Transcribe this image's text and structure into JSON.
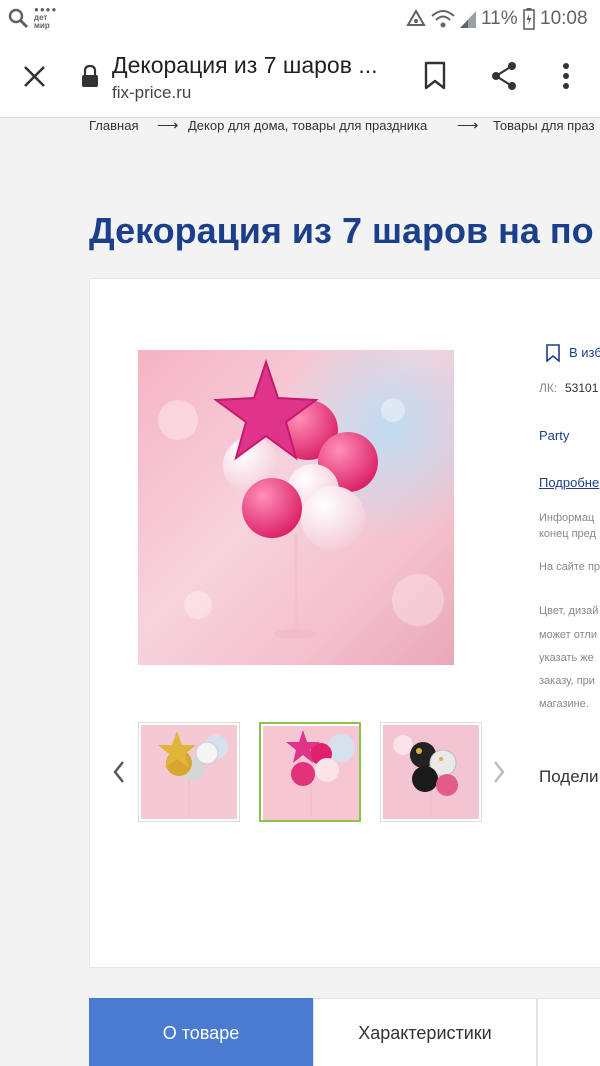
{
  "status_bar": {
    "app_badge": "дет мир",
    "battery": "11%",
    "time": "10:08"
  },
  "browser": {
    "title": "Декорация из 7 шаров ...",
    "url": "fix-price.ru"
  },
  "breadcrumb": [
    {
      "label": "Главная"
    },
    {
      "label": "Декор для дома, товары для праздника"
    },
    {
      "label": "Товары для праз"
    }
  ],
  "breadcrumb_separator": "⟶",
  "product": {
    "title": "Декорация из 7 шаров на по",
    "favorite_label": "В изб",
    "sku_label": "ЛК:",
    "sku_value": "53101",
    "brand": "Party",
    "details_link": "Подробне",
    "info_lines": [
      "Информац",
      "конец пред"
    ],
    "site_note": "На сайте пр",
    "disclaimer_lines": [
      "Цвет, дизай",
      "может отли",
      "указать же",
      "заказу, при",
      "магазине."
    ],
    "share_label": "Подели"
  },
  "tabs": [
    {
      "label": "О товаре",
      "active": true
    },
    {
      "label": "Характеристики",
      "active": false
    }
  ],
  "colors": {
    "accent_blue": "#1b3f8b",
    "tab_active": "#4a7bd0",
    "link": "#1b3f8b",
    "thumb_active_border": "#8bc34a"
  }
}
